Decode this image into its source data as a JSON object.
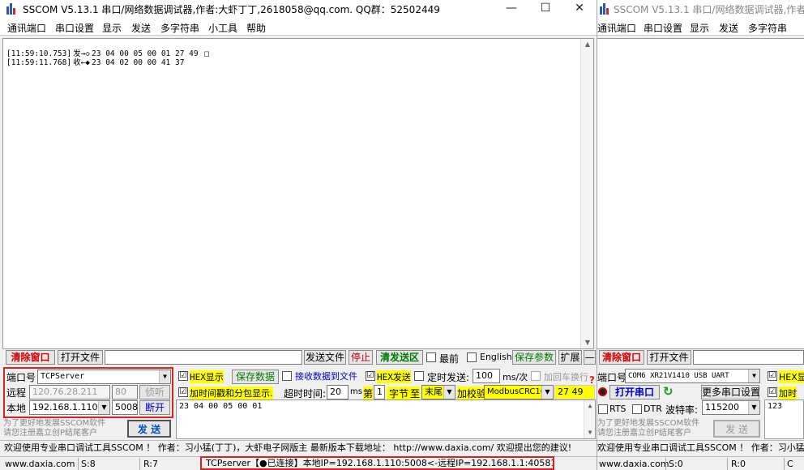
{
  "app_title": "SSCOM V5.13.1 串口/网络数据调试器,作者:大虾丁丁,2618058@qq.com. QQ群：52502449",
  "app_title_b": "SSCOM V5.13.1 串口/网络数据调试器,作者:大",
  "window_controls": {
    "minimize": "—",
    "maximize": "☐",
    "close": "✕"
  },
  "menu": [
    "通讯端口",
    "串口设置",
    "显示",
    "发送",
    "多字符串",
    "小工具",
    "帮助"
  ],
  "menu_b": [
    "通讯端口",
    "串口设置",
    "显示",
    "发送",
    "多字符串"
  ],
  "receive_log": [
    {
      "time": "[11:59:10.753]",
      "dir": "发→◇",
      "data": "23 04 00 05 00 01 27 49",
      "tail": "□"
    },
    {
      "time": "[11:59:11.768]",
      "dir": "收←◆",
      "data": "23 04 02 00 00 41 37",
      "tail": ""
    }
  ],
  "toolbar": {
    "clear_window": "清除窗口",
    "open_file": "打开文件",
    "file_path": "",
    "send_file": "发送文件",
    "stop": "停止",
    "clear_send": "清发送区",
    "topmost": "最前",
    "english": "English",
    "save_params": "保存参数",
    "expand": "扩展",
    "dash": "—"
  },
  "net": {
    "port_label": "端口号",
    "port_value": "TCPServer",
    "remote_label": "远程",
    "remote_ip": "120.76.28.211",
    "remote_port": "80",
    "listen": "侦听",
    "local_label": "本地",
    "local_ip": "192.168.1.110",
    "local_port": "5008",
    "disconnect": "断开"
  },
  "options": {
    "hex_display": "HEX显示",
    "hex_display_checked": "☑",
    "save_data": "保存数据",
    "recv_to_file": "接收数据到文件",
    "hex_send": "HEX发送",
    "hex_send_checked": "☑",
    "timed_send": "定时发送:",
    "interval": "100",
    "interval_unit": "ms/次",
    "add_crlf": "加回车换行",
    "timestamp": "加时间戳和分包显示.",
    "timestamp_checked": "☑",
    "timeout_label": "超时时间:",
    "timeout_value": "20",
    "timeout_unit": "ms",
    "byte_prefix": "第",
    "byte_num": "1",
    "byte_unit": "字节",
    "to": "至",
    "end": "末尾",
    "checksum_label": "加校验",
    "checksum_type": "ModbusCRC16",
    "checksum_value": "27 49",
    "question": "?"
  },
  "send_text": "23 04 00 05 00 01",
  "send_button": "发 送",
  "promo_line1": "为了更好地发展SSCOM软件",
  "promo_line2": "请您注册嘉立创P结尾客户",
  "marquee": "欢迎使用专业串口调试工具SSCOM ！  作者：习小猛(丁丁)，大虾电子网版主  最新版本下载地址： http://www.daxia.com/  欢迎提出您的建议!",
  "status": {
    "site": "www.daxia.com",
    "sent": "S:8",
    "recv": "R:7",
    "connection": "TCPserver【●已连接】本地IP=192.168.1.110:5008<-远程IP=192.168.1.1:40581"
  },
  "win_b": {
    "port_label": "端口号",
    "port_value": "COM6 XR21V1410 USB UART",
    "hex_display": "HEX显",
    "open_port": "打开串口",
    "more_settings": "更多串口设置",
    "add_time": "加时",
    "rts": "RTS",
    "dtr": "DTR",
    "baud_label": "波特率:",
    "baud_value": "115200",
    "send_text": "123",
    "send_button": "发 送",
    "status_site": "www.daxia.com",
    "sent": "S:0",
    "recv": "R:0",
    "status_tail": "C"
  }
}
